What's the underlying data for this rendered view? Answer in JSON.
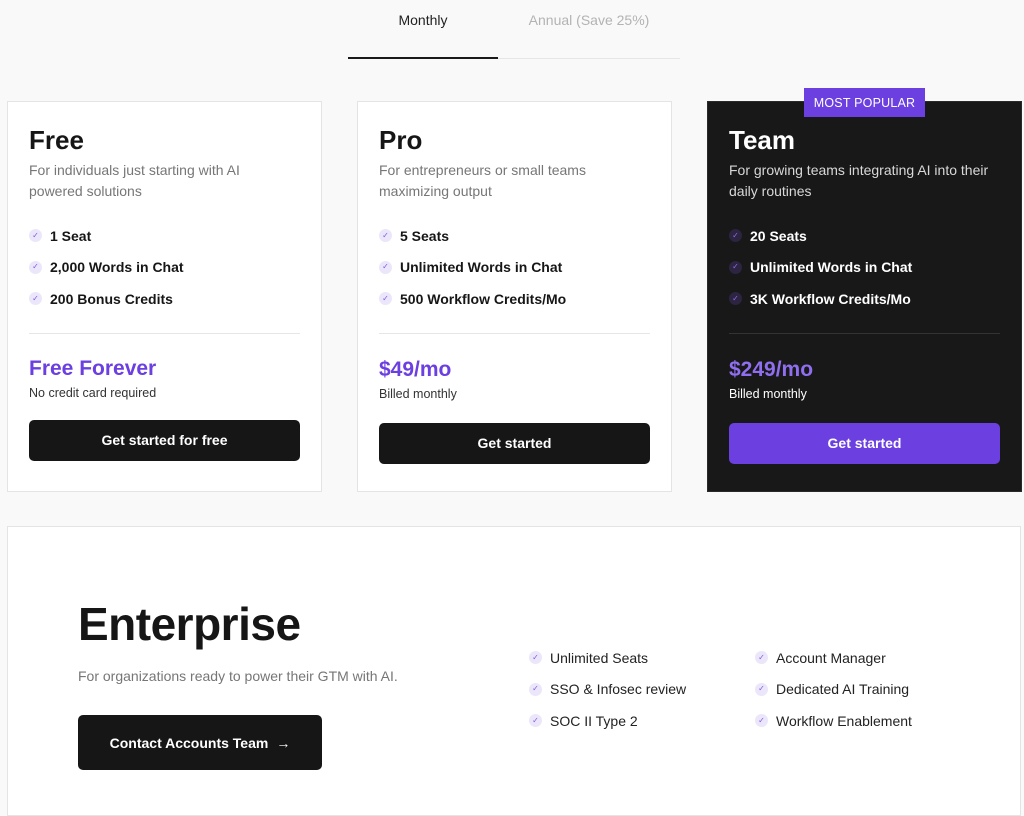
{
  "billing_tabs": [
    {
      "label": "Monthly",
      "active": true
    },
    {
      "label": "Annual (Save 25%)",
      "active": false
    }
  ],
  "plans": [
    {
      "name": "Free",
      "description": "For individuals just starting with AI powered solutions",
      "features": [
        "1 Seat",
        "2,000 Words in Chat",
        "200 Bonus Credits"
      ],
      "price": "Free Forever",
      "price_note": "No credit card required",
      "cta": "Get started for free"
    },
    {
      "name": "Pro",
      "description": "For entrepreneurs or small teams maximizing output",
      "features": [
        "5 Seats",
        "Unlimited Words in Chat",
        "500 Workflow Credits/Mo"
      ],
      "price": "$49/mo",
      "price_note": "Billed monthly",
      "cta": "Get started"
    },
    {
      "name": "Team",
      "badge": "MOST POPULAR",
      "description": "For growing teams integrating AI into their daily routines",
      "features": [
        "20 Seats",
        "Unlimited Words in Chat",
        "3K Workflow Credits/Mo"
      ],
      "price": "$249/mo",
      "price_note": "Billed monthly",
      "cta": "Get started"
    }
  ],
  "enterprise": {
    "title": "Enterprise",
    "description": "For organizations ready to power their GTM with AI.",
    "cta": "Contact Accounts Team",
    "cta_icon": "→",
    "features": [
      "Unlimited Seats",
      "Account Manager",
      "SSO & Infosec review",
      "Dedicated AI Training",
      "SOC II Type 2",
      "Workflow Enablement"
    ]
  },
  "icons": {
    "check": "✓"
  },
  "colors": {
    "accent": "#6b3fe0",
    "dark": "#161616",
    "team_bg": "#181818"
  }
}
